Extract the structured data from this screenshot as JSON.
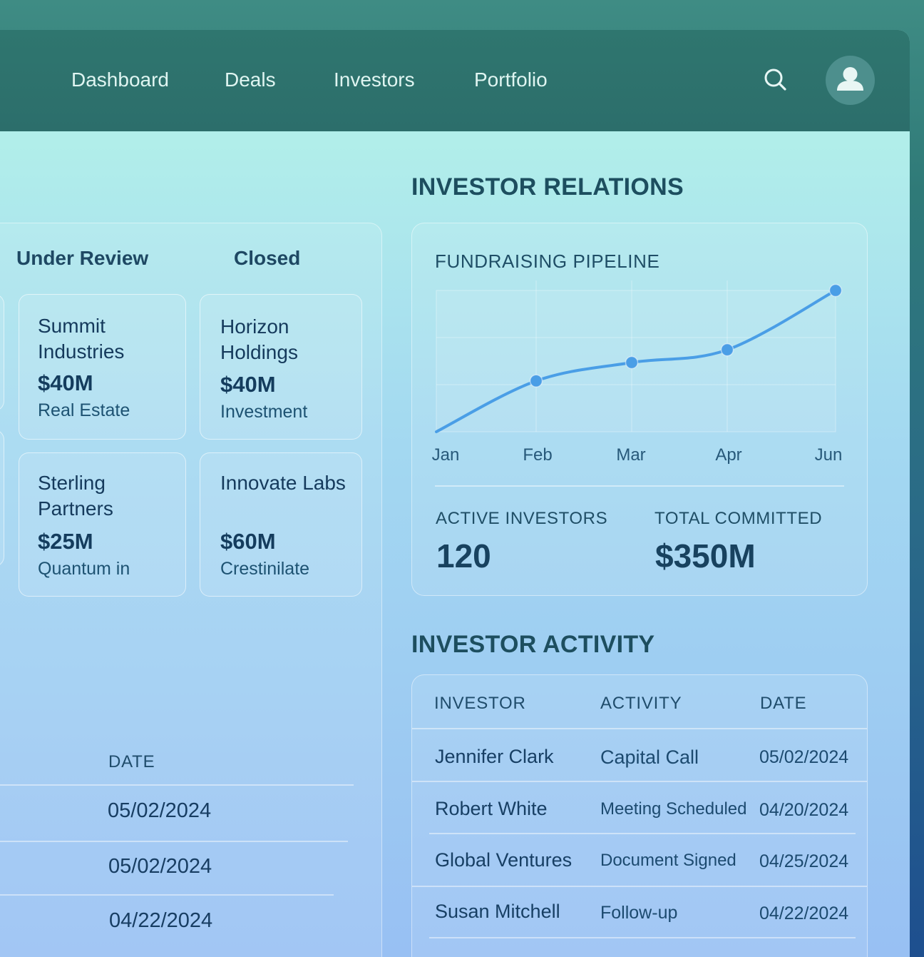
{
  "nav": {
    "items": [
      "Dashboard",
      "Deals",
      "Investors",
      "Portfolio"
    ]
  },
  "deals": {
    "columns": [
      "Under Review",
      "Closed"
    ],
    "cards": [
      {
        "name": "Summit Industries",
        "amount": "$40M",
        "category": "Real Estate"
      },
      {
        "name": "Horizon Holdings",
        "amount": "$40M",
        "category": "Investment"
      },
      {
        "name": "Sterling Partners",
        "amount": "$25M",
        "category": "Quantum in"
      },
      {
        "name": "Innovate Labs",
        "amount": "$60M",
        "category": "Crestinilate"
      }
    ]
  },
  "left_table": {
    "date_header": "DATE",
    "dates": [
      "05/02/2024",
      "05/02/2024",
      "04/22/2024"
    ]
  },
  "investor_relations": {
    "title": "INVESTOR RELATIONS",
    "chart_title": "FUNDRAISING PIPELINE",
    "active_investors_label": "ACTIVE INVESTORS",
    "active_investors_value": "120",
    "total_committed_label": "TOTAL COMMITTED",
    "total_committed_value": "$350M"
  },
  "chart_data": {
    "type": "line",
    "title": "FUNDRAISING PIPELINE",
    "x": [
      "Jan",
      "Feb",
      "Mar",
      "Apr",
      "Jun"
    ],
    "series": [
      {
        "values": [
          0,
          36,
          49,
          58,
          100
        ]
      }
    ],
    "ylim": [
      0,
      100
    ],
    "grid": true,
    "color": "#4a9ee6"
  },
  "investor_activity": {
    "title": "INVESTOR ACTIVITY",
    "headers": [
      "INVESTOR",
      "ACTIVITY",
      "DATE"
    ],
    "rows": [
      {
        "investor": "Jennifer Clark",
        "activity": "Capital Call",
        "date": "05/02/2024"
      },
      {
        "investor": "Robert White",
        "activity": "Meeting Scheduled",
        "date": "04/20/2024"
      },
      {
        "investor": "Global Ventures",
        "activity": "Document Signed",
        "date": "04/25/2024"
      },
      {
        "investor": "Susan Mitchell",
        "activity": "Follow-up",
        "date": "04/22/2024"
      }
    ]
  },
  "icons": {
    "search": "search-icon",
    "avatar": "user-icon"
  }
}
